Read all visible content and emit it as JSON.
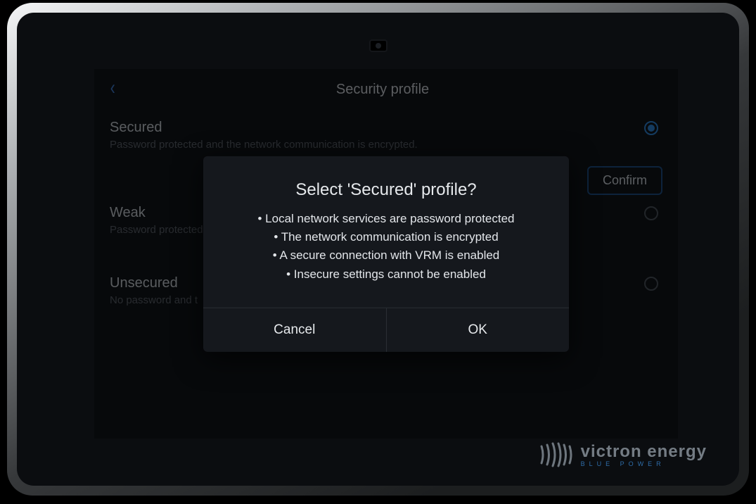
{
  "header": {
    "title": "Security profile"
  },
  "options": [
    {
      "title": "Secured",
      "description": "Password protected and the network communication is encrypted.",
      "selected": true
    },
    {
      "title": "Weak",
      "description": "Password protected",
      "selected": false
    },
    {
      "title": "Unsecured",
      "description": "No password and t",
      "selected": false
    }
  ],
  "confirm_button": "Confirm",
  "dialog": {
    "title": "Select 'Secured' profile?",
    "bullets": [
      "Local network services are password protected",
      "The network communication is encrypted",
      "A secure connection with VRM is enabled",
      "Insecure settings cannot be enabled"
    ],
    "cancel": "Cancel",
    "ok": "OK"
  },
  "brand": {
    "name": "victron energy",
    "tagline": "BLUE POWER"
  },
  "colors": {
    "accent": "#2d83d6",
    "panel": "#15181d"
  }
}
